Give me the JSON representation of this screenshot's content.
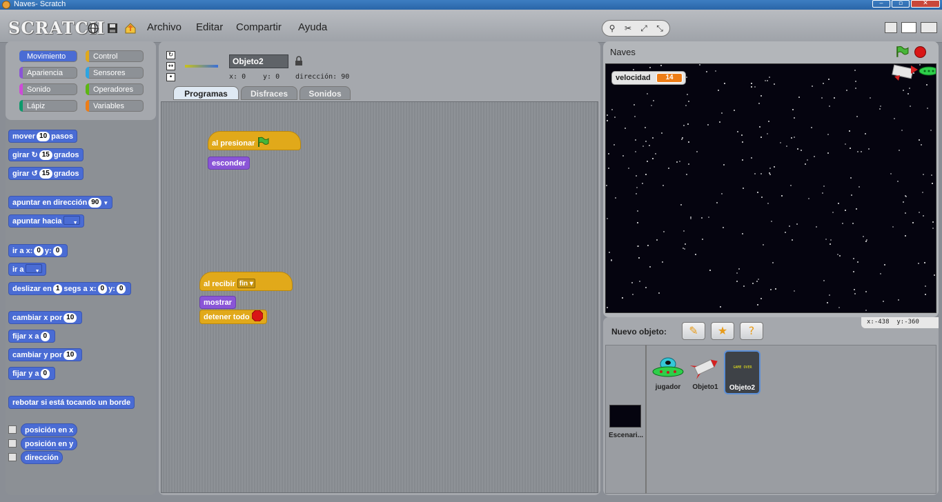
{
  "window": {
    "title": "Naves- Scratch"
  },
  "menubar": {
    "logo": "SCRATCH",
    "menus": [
      "Archivo",
      "Editar",
      "Compartir",
      "Ayuda"
    ]
  },
  "categories": [
    {
      "label": "Movimiento",
      "color": "#4a6cd4",
      "selected": true
    },
    {
      "label": "Control",
      "color": "#e1a91a",
      "selected": false
    },
    {
      "label": "Apariencia",
      "color": "#8a55d7",
      "selected": false
    },
    {
      "label": "Sensores",
      "color": "#2ca5e2",
      "selected": false
    },
    {
      "label": "Sonido",
      "color": "#cf4ad9",
      "selected": false
    },
    {
      "label": "Operadores",
      "color": "#5cb712",
      "selected": false
    },
    {
      "label": "Lápiz",
      "color": "#0e9a6c",
      "selected": false
    },
    {
      "label": "Variables",
      "color": "#ee7d16",
      "selected": false
    }
  ],
  "palette": {
    "mover": {
      "a": "mover",
      "v": "10",
      "b": "pasos"
    },
    "girar_right": {
      "a": "girar",
      "v": "15",
      "b": "grados"
    },
    "girar_left": {
      "a": "girar",
      "v": "15",
      "b": "grados"
    },
    "apuntar_dir": {
      "a": "apuntar en dirección",
      "v": "90"
    },
    "apuntar_hacia": {
      "a": "apuntar hacia"
    },
    "ir_xy": {
      "a": "ir a x:",
      "x": "0",
      "b": "y:",
      "y": "0"
    },
    "ir_a": {
      "a": "ir a"
    },
    "deslizar": {
      "a": "deslizar en",
      "s": "1",
      "b": "segs a x:",
      "x": "0",
      "c": "y:",
      "y": "0"
    },
    "cambiar_x": {
      "a": "cambiar x por",
      "v": "10"
    },
    "fijar_x": {
      "a": "fijar x a",
      "v": "0"
    },
    "cambiar_y": {
      "a": "cambiar y por",
      "v": "10"
    },
    "fijar_y": {
      "a": "fijar y a",
      "v": "0"
    },
    "rebotar": {
      "a": "rebotar si está tocando un borde"
    },
    "reporters": [
      "posición en x",
      "posición en y",
      "dirección"
    ]
  },
  "sprite": {
    "name": "Objeto2",
    "x_label": "x:",
    "x": "0",
    "y_label": "y:",
    "y": "0",
    "dir_label": "dirección:",
    "dir": "90",
    "tabs": [
      "Programas",
      "Disfraces",
      "Sonidos"
    ]
  },
  "scripts": {
    "s1_hat": "al presionar",
    "s1_block": "esconder",
    "s2_hat": "al recibir",
    "s2_msg": "fin",
    "s2_b1": "mostrar",
    "s2_b2": "detener todo"
  },
  "stage": {
    "title": "Naves",
    "var_name": "velocidad",
    "var_value": "14",
    "mouse_x_label": "x:",
    "mouse_x": "-438",
    "mouse_y_label": "y:",
    "mouse_y": "-360"
  },
  "sprites_panel": {
    "new_label": "Nuevo objeto:",
    "sprites": [
      "jugador",
      "Objeto1",
      "Objeto2"
    ],
    "selected": "Objeto2",
    "stage_label": "Escenari...",
    "game_over_text": "GAME OVER"
  },
  "icons": {
    "globe": "globe-icon",
    "save": "save-icon",
    "share": "share-icon",
    "flag": "green-flag-icon",
    "stop": "stop-icon",
    "lock": "lock-icon"
  }
}
